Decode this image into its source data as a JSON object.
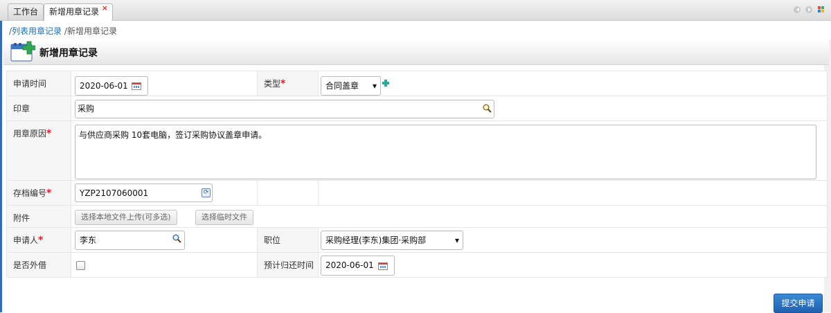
{
  "tabs": [
    {
      "label": "工作台"
    },
    {
      "label": "新增用章记录",
      "close": "×"
    }
  ],
  "breadcrumb": {
    "sep1": "/",
    "link": "列表用章记录",
    "sep2": "/",
    "current": "新增用章记录"
  },
  "page_title": "新增用章记录",
  "form": {
    "apply_time": {
      "label": "申请时间",
      "value": "2020-06-01"
    },
    "type": {
      "label": "类型",
      "required": "*",
      "value": "合同盖章",
      "arrow": "▾"
    },
    "seal": {
      "label": "印章",
      "value": "采购"
    },
    "reason": {
      "label": "用章原因",
      "required": "*",
      "value": "与供应商采购 10套电脑，签订采购协议盖章申请。"
    },
    "archive_no": {
      "label": "存档编号",
      "required": "*",
      "value": "YZP2107060001"
    },
    "attachment": {
      "label": "附件",
      "upload_button": "选择本地文件上传(可多选)",
      "temp_button": "选择临时文件"
    },
    "applicant": {
      "label": "申请人",
      "required": "*",
      "value": "李东"
    },
    "position": {
      "label": "职位",
      "value": "采购经理(李东)集团·采购部",
      "arrow": "▾"
    },
    "borrow_out": {
      "label": "是否外借",
      "checked": false
    },
    "return_time": {
      "label": "预计归还时间",
      "value": "2020-06-01"
    }
  },
  "submit_label": "提交申请",
  "colors": {
    "accent": "#1e61b0",
    "required": "#e02020",
    "tab_close": "#d9331f",
    "link": "#1a6fb5"
  },
  "icons": [
    "calendar-icon",
    "magnifier-icon",
    "add-icon",
    "refresh-icon",
    "prev-icon",
    "next-icon",
    "grid-icon",
    "page-add-icon"
  ]
}
